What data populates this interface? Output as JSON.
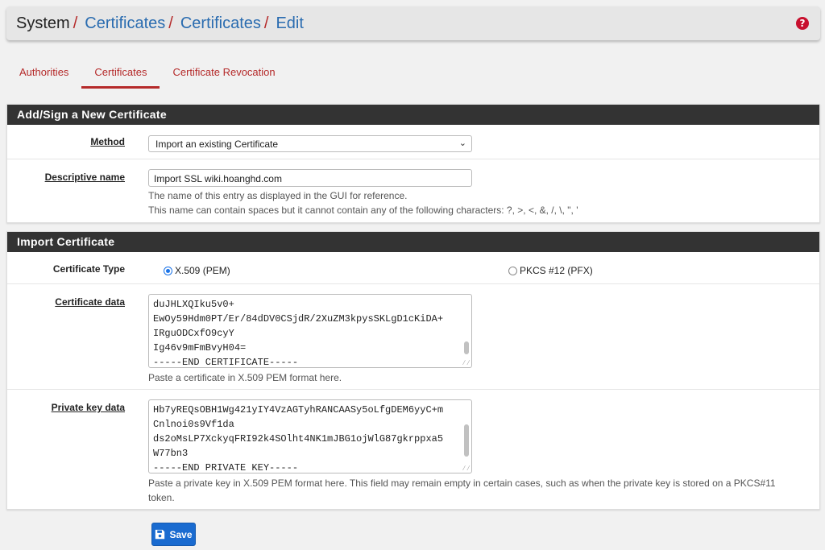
{
  "breadcrumb": {
    "items": [
      "System",
      "Certificates",
      "Certificates",
      "Edit"
    ],
    "separator": "/"
  },
  "tabs": [
    {
      "label": "Authorities",
      "active": false
    },
    {
      "label": "Certificates",
      "active": true
    },
    {
      "label": "Certificate Revocation",
      "active": false
    }
  ],
  "panel_add": {
    "heading": "Add/Sign a New Certificate",
    "method_label": "Method",
    "method_value": "Import an existing Certificate",
    "descr_label": "Descriptive name",
    "descr_value": "Import SSL wiki.hoanghd.com",
    "descr_help1": "The name of this entry as displayed in the GUI for reference.",
    "descr_help2": "This name can contain spaces but it cannot contain any of the following characters: ?, >, <, &, /, \\, \", '"
  },
  "panel_import": {
    "heading": "Import Certificate",
    "cert_type_label": "Certificate Type",
    "cert_type_options": [
      {
        "label": "X.509 (PEM)",
        "checked": true
      },
      {
        "label": "PKCS #12 (PFX)",
        "checked": false
      }
    ],
    "cert_data_label": "Certificate data",
    "cert_data_lines": [
      "duJHLXQIku5v0+",
      "EwOy59Hdm0PT/Er/84dDV0CSjdR/2XuZM3kpysSKLgD1cKiDA+",
      "IRguODCxfO9cyY",
      "Ig46v9mFmBvyH04=",
      "-----END CERTIFICATE-----"
    ],
    "cert_data_help": "Paste a certificate in X.509 PEM format here.",
    "key_data_label": "Private key data",
    "key_data_lines": [
      "Hb7yREQsOBH1Wg421yIY4VzAGTyhRANCAASy5oLfgDEM6yyC+m",
      "Cnlnoi0s9Vf1da",
      "ds2oMsLP7XckyqFRI92k4SOlht4NK1mJBG1ojWlG87gkrppxa5",
      "W77bn3",
      "-----END PRIVATE KEY-----"
    ],
    "key_data_help1": "Paste a private key in X.509 PEM format here. This field may remain empty in certain cases, such as when the private key is stored on a PKCS#11",
    "key_data_help2": "token."
  },
  "save_label": "Save",
  "icons": {
    "help": "question-circle-icon",
    "save": "floppy-disk-icon",
    "dropdown": "chevron-down-icon"
  },
  "colors": {
    "link": "#2a6cb0",
    "accent_red": "#b52a2a",
    "heading_bg": "#333333",
    "button": "#1a6bd0"
  }
}
